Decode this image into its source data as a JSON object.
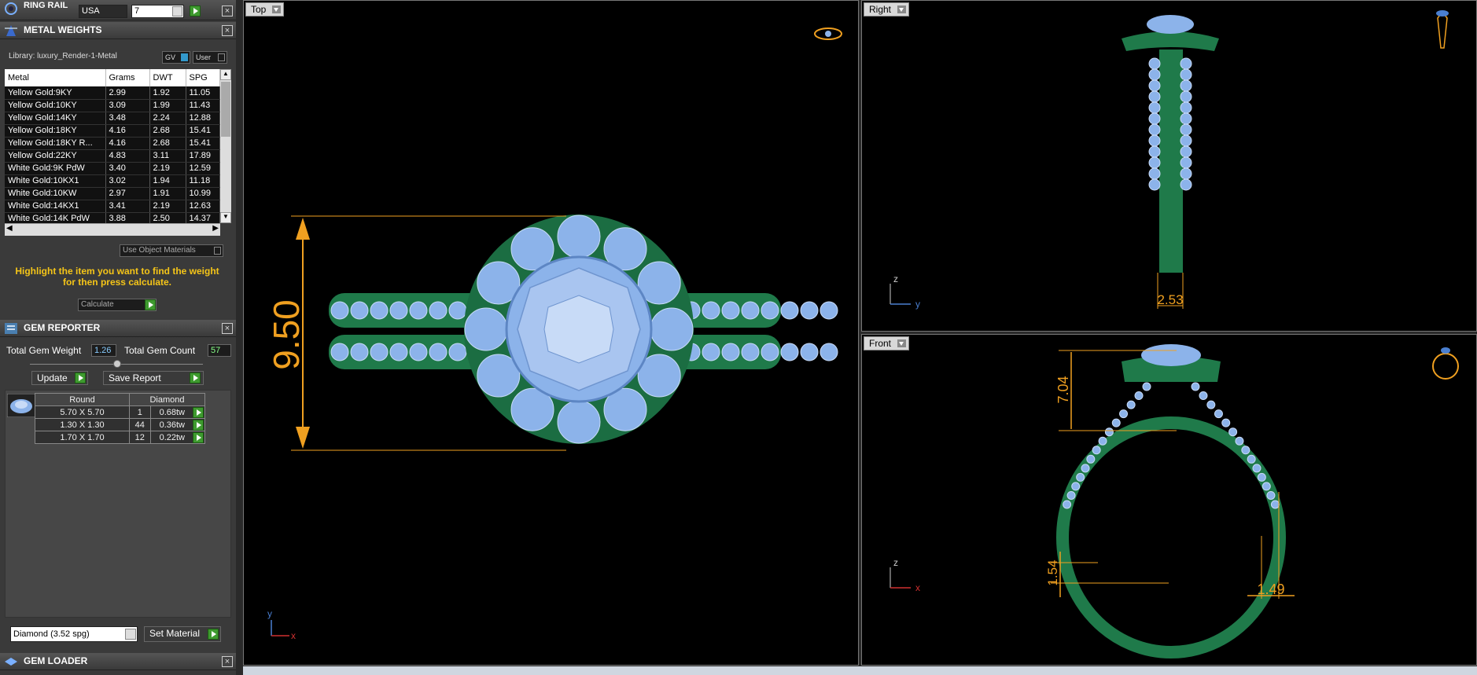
{
  "ring_rail": {
    "title": "RING RAIL",
    "country": "USA",
    "size": "7"
  },
  "metal_weights": {
    "title": "METAL WEIGHTS",
    "library": "Library: luxury_Render-1-Metal",
    "gv_label": "GV",
    "user_label": "User",
    "columns": [
      "Metal",
      "Grams",
      "DWT",
      "SPG"
    ],
    "rows": [
      [
        "Yellow Gold:9KY",
        "2.99",
        "1.92",
        "11.05"
      ],
      [
        "Yellow Gold:10KY",
        "3.09",
        "1.99",
        "11.43"
      ],
      [
        "Yellow Gold:14KY",
        "3.48",
        "2.24",
        "12.88"
      ],
      [
        "Yellow Gold:18KY",
        "4.16",
        "2.68",
        "15.41"
      ],
      [
        "Yellow Gold:18KY R...",
        "4.16",
        "2.68",
        "15.41"
      ],
      [
        "Yellow Gold:22KY",
        "4.83",
        "3.11",
        "17.89"
      ],
      [
        "White Gold:9K PdW",
        "3.40",
        "2.19",
        "12.59"
      ],
      [
        "White Gold:10KX1",
        "3.02",
        "1.94",
        "11.18"
      ],
      [
        "White Gold:10KW",
        "2.97",
        "1.91",
        "10.99"
      ],
      [
        "White Gold:14KX1",
        "3.41",
        "2.19",
        "12.63"
      ],
      [
        "White Gold:14K PdW",
        "3.88",
        "2.50",
        "14.37"
      ]
    ],
    "use_object_materials": "Use Object Materials",
    "instruction": "Highlight the item you want to find the weight for then press calculate.",
    "calculate_label": "Calculate"
  },
  "gem_reporter": {
    "title": "GEM REPORTER",
    "total_weight_label": "Total Gem Weight",
    "total_weight_value": "1.26",
    "total_count_label": "Total Gem Count",
    "total_count_value": "57",
    "update_label": "Update",
    "save_report_label": "Save Report",
    "header_shape": "Round",
    "header_type": "Diamond",
    "gems": [
      [
        "5.70 X 5.70",
        "1",
        "0.68tw"
      ],
      [
        "1.30 X 1.30",
        "44",
        "0.36tw"
      ],
      [
        "1.70 X 1.70",
        "12",
        "0.22tw"
      ]
    ],
    "material_select": "Diamond     (3.52 spg)",
    "set_material_label": "Set Material"
  },
  "gem_loader": {
    "title": "GEM LOADER"
  },
  "viewports": {
    "top": {
      "label": "Top",
      "dimension": "9.50"
    },
    "right": {
      "label": "Right",
      "dimension": "2.53"
    },
    "front": {
      "label": "Front",
      "dimension_a": "7.04",
      "dimension_b": "1.54",
      "dimension_c": "1.49"
    }
  },
  "axes": {
    "x": "x",
    "y": "y",
    "z": "z"
  },
  "colors": {
    "metal": "#1f7a4a",
    "gem": "#8cb3ea",
    "dimension": "#f0a020",
    "instruction": "#f5c518"
  }
}
